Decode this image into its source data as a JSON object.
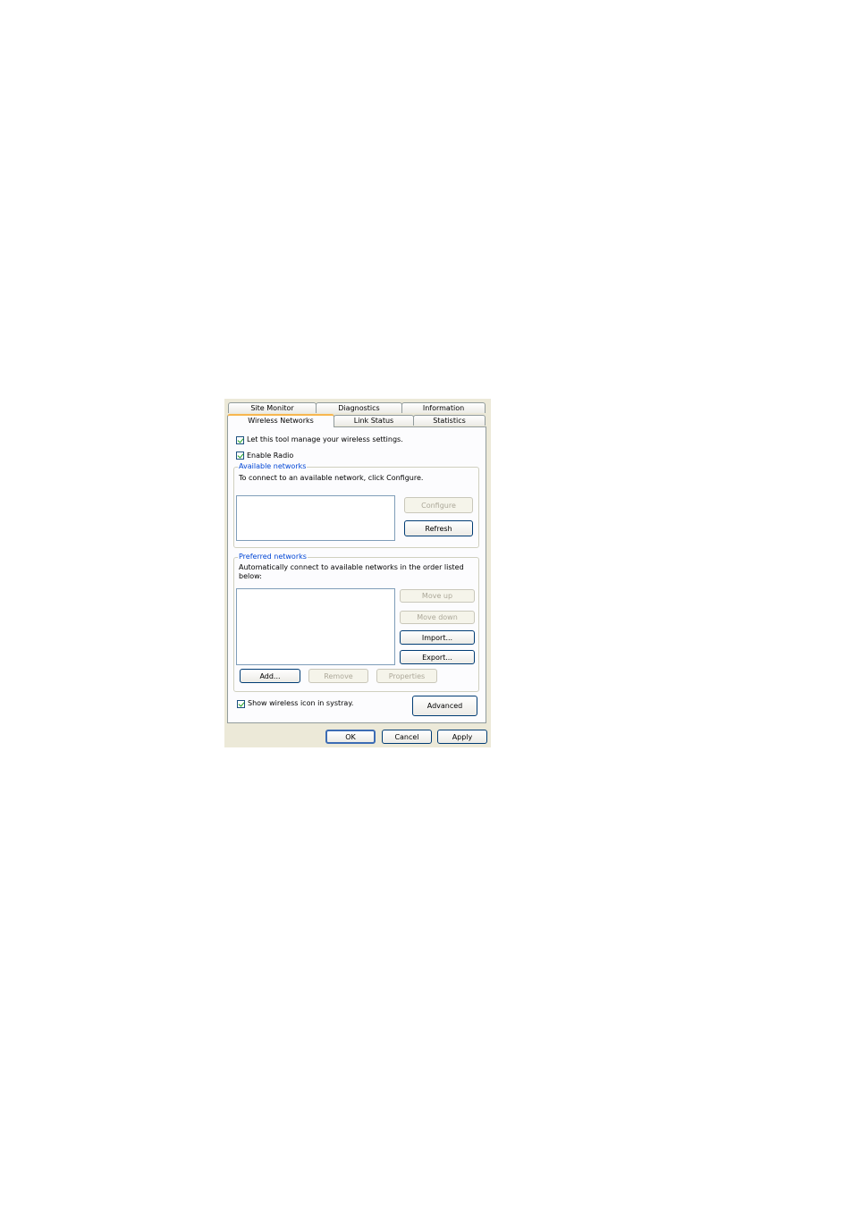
{
  "tabs": {
    "row_back": [
      "Site Monitor",
      "Diagnostics",
      "Information"
    ],
    "row_front": [
      "Wireless Networks",
      "Link Status",
      "Statistics"
    ]
  },
  "options": {
    "manage_label": "Let this tool manage your wireless settings.",
    "manage_checked": true,
    "radio_label": "Enable Radio",
    "radio_checked": true,
    "systray_label": "Show wireless icon in systray.",
    "systray_checked": true
  },
  "available": {
    "title": "Available networks",
    "desc": "To connect to an available network, click Configure.",
    "configure_label": "Configure",
    "refresh_label": "Refresh"
  },
  "preferred": {
    "title": "Preferred networks",
    "desc_line1": "Automatically connect to available networks in the order listed",
    "desc_line2": "below:",
    "move_up_label": "Move up",
    "move_down_label": "Move down",
    "import_label": "Import...",
    "export_label": "Export...",
    "add_label": "Add...",
    "remove_label": "Remove",
    "properties_label": "Properties"
  },
  "advanced_label": "Advanced",
  "footer": {
    "ok_label": "OK",
    "cancel_label": "Cancel",
    "apply_label": "Apply"
  }
}
